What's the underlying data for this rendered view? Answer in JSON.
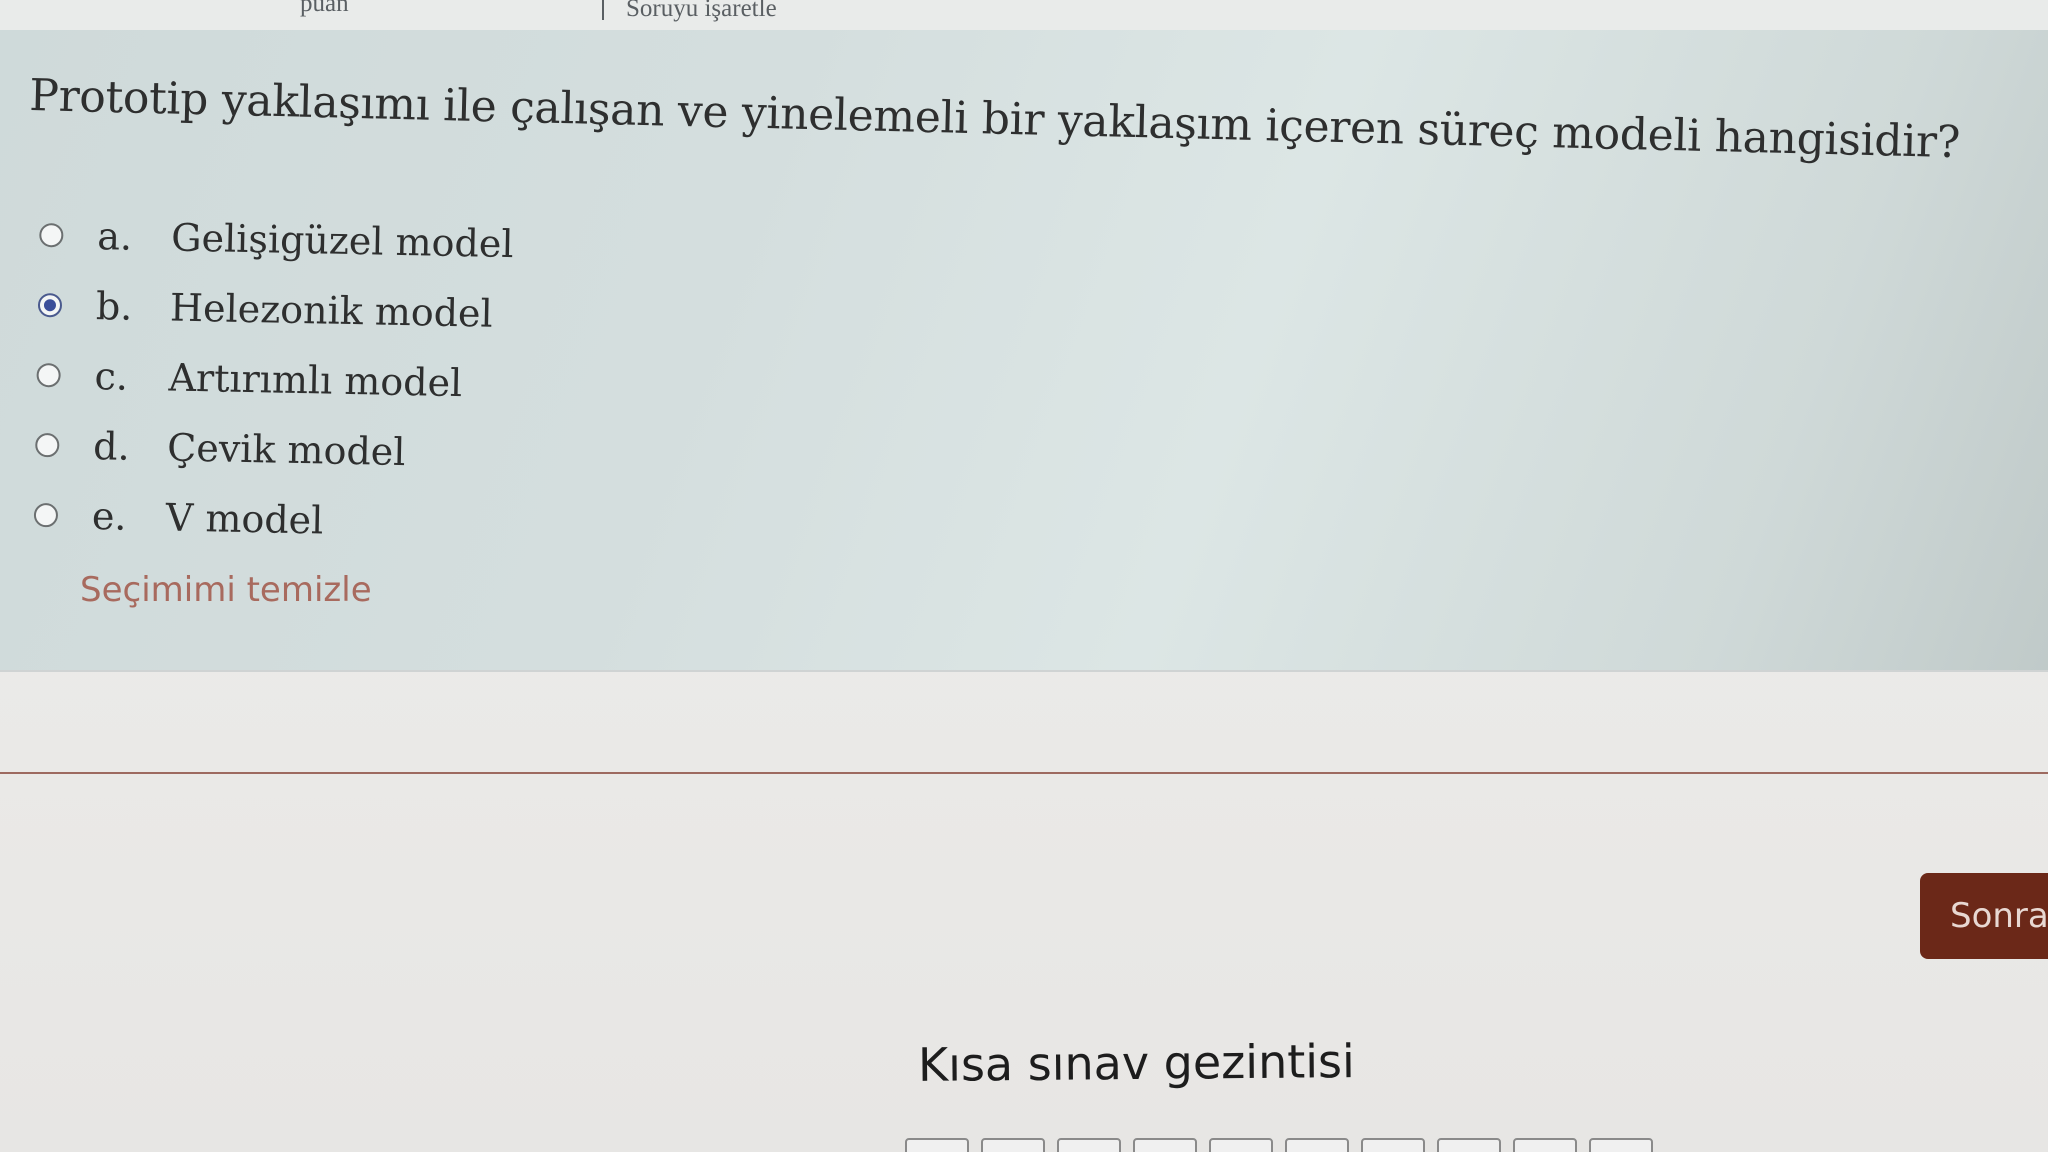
{
  "header": {
    "marks_text": "puan",
    "flag_label": "Soruyu işaretle"
  },
  "question": {
    "text": "Prototip yaklaşımı ile çalışan ve yinelemeli bir yaklaşım içeren süreç modeli hangisidir?",
    "answers": [
      {
        "letter": "a.",
        "label": "Gelişigüzel model",
        "selected": false
      },
      {
        "letter": "b.",
        "label": "Helezonik model",
        "selected": true
      },
      {
        "letter": "c.",
        "label": "Artırımlı model",
        "selected": false
      },
      {
        "letter": "d.",
        "label": "Çevik model",
        "selected": false
      },
      {
        "letter": "e.",
        "label": "V model",
        "selected": false
      }
    ],
    "clear_choice_label": "Seçimimi temizle"
  },
  "navigation": {
    "next_label": "Sonrak",
    "quiz_nav_title": "Kısa sınav gezintisi"
  },
  "colors": {
    "selected_radio": "#3b4f9a",
    "next_button": "#6b2818",
    "clear_link": "#a86a5e"
  }
}
